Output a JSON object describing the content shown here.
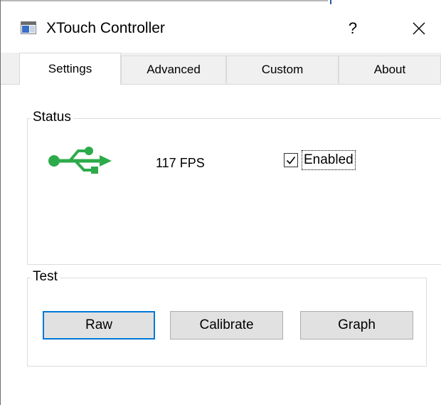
{
  "window": {
    "title": "XTouch Controller",
    "help_glyph": "?",
    "close_glyph": "✕"
  },
  "tabs": [
    {
      "label": "Settings",
      "active": true
    },
    {
      "label": "Advanced",
      "active": false
    },
    {
      "label": "Custom",
      "active": false
    },
    {
      "label": "About",
      "active": false
    }
  ],
  "status": {
    "title": "Status",
    "icon": "usb-icon",
    "fps": "117 FPS",
    "enabled_label": "Enabled",
    "enabled_checked": true
  },
  "test": {
    "title": "Test",
    "buttons": [
      {
        "label": "Raw",
        "default": true
      },
      {
        "label": "Calibrate",
        "default": false
      },
      {
        "label": "Graph",
        "default": false
      }
    ]
  },
  "colors": {
    "usb": "#2dab4b",
    "focus": "#0078d7"
  }
}
